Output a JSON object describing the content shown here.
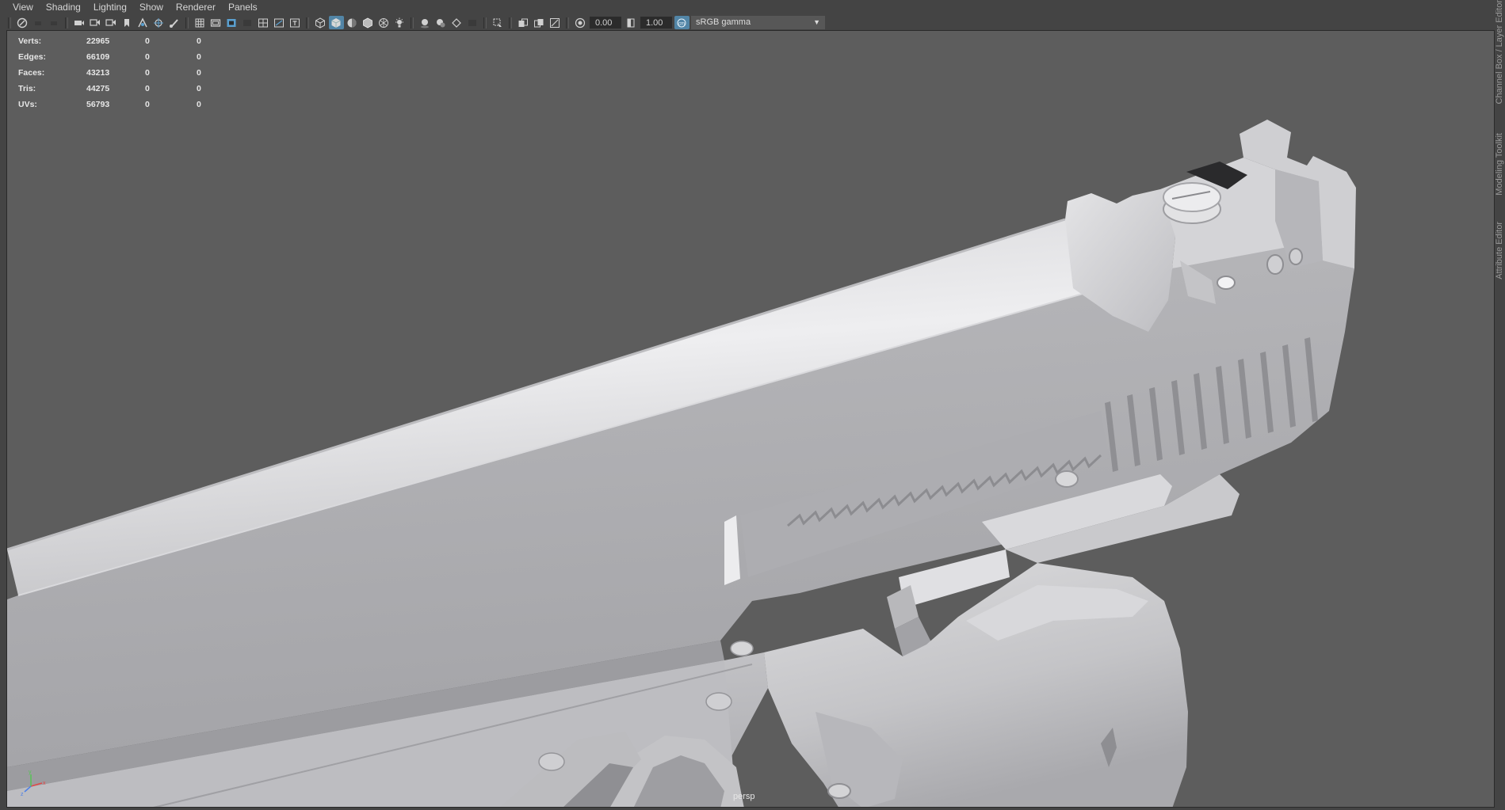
{
  "menu": [
    "View",
    "Shading",
    "Lighting",
    "Show",
    "Renderer",
    "Panels"
  ],
  "toolbar": {
    "exposure_value": "0.00",
    "gamma_value": "1.00",
    "color_space": "sRGB gamma"
  },
  "hud": {
    "rows": [
      {
        "label": "Verts:",
        "value": "22965",
        "a": "0",
        "b": "0"
      },
      {
        "label": "Edges:",
        "value": "66109",
        "a": "0",
        "b": "0"
      },
      {
        "label": "Faces:",
        "value": "43213",
        "a": "0",
        "b": "0"
      },
      {
        "label": "Tris:",
        "value": "44275",
        "a": "0",
        "b": "0"
      },
      {
        "label": "UVs:",
        "value": "56793",
        "a": "0",
        "b": "0"
      }
    ]
  },
  "viewport": {
    "camera_label": "persp",
    "background_color": "#5d5d5d"
  },
  "side_tabs": [
    "Channel Box / Layer Editor",
    "Modeling Toolkit",
    "Attribute Editor"
  ]
}
